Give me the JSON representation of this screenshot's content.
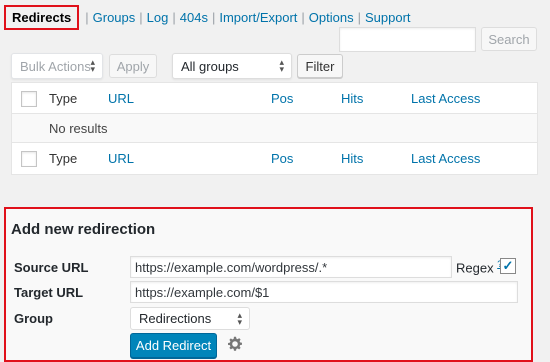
{
  "subnav": {
    "items": [
      {
        "label": "Redirects",
        "current": true
      },
      {
        "label": "Groups"
      },
      {
        "label": "Log"
      },
      {
        "label": "404s"
      },
      {
        "label": "Import/Export"
      },
      {
        "label": "Options"
      },
      {
        "label": "Support"
      }
    ],
    "separator": "|"
  },
  "search": {
    "value": "",
    "button_label": "Search"
  },
  "toolbar": {
    "bulk_actions": "Bulk Actions",
    "apply": "Apply",
    "groups_filter": "All groups",
    "filter": "Filter"
  },
  "table": {
    "columns": [
      "Type",
      "URL",
      "Pos",
      "Hits",
      "Last Access"
    ],
    "empty_message": "No results"
  },
  "add_redirect": {
    "title": "Add new redirection",
    "source_label": "Source URL",
    "source_value": "https://example.com/wordpress/.*",
    "regex_label": "Regex",
    "regex_help": "?",
    "regex_checked": true,
    "target_label": "Target URL",
    "target_value": "https://example.com/$1",
    "group_label": "Group",
    "group_value": "Redirections",
    "submit_label": "Add Redirect"
  },
  "colors": {
    "accent": "#0085ba",
    "link": "#0073aa",
    "highlight": "#e0101a"
  }
}
